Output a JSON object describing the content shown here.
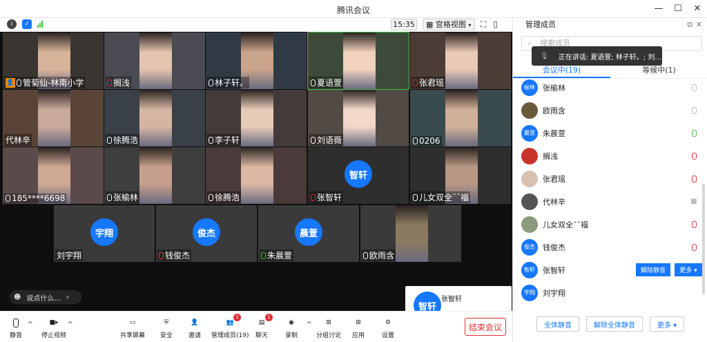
{
  "window": {
    "title": "腾讯会议"
  },
  "toolbar": {
    "time": "15:35",
    "view_label": "宫格视图"
  },
  "tiles": [
    {
      "name": "管菊仙-林南小学",
      "mic": "on",
      "host": true
    },
    {
      "name": "搁浅",
      "mic": "muted"
    },
    {
      "name": "林子轩。",
      "mic": "on"
    },
    {
      "name": "夏语萱",
      "mic": "on"
    },
    {
      "name": "张君瑶",
      "mic": "muted"
    },
    {
      "name": "代林辛",
      "mic": "none"
    },
    {
      "name": "徐腾浩",
      "mic": "on"
    },
    {
      "name": "李子轩",
      "mic": "on"
    },
    {
      "name": "刘语薇",
      "mic": "on"
    },
    {
      "name": "0206",
      "mic": "on"
    },
    {
      "name": "185****6698",
      "mic": "on"
    },
    {
      "name": "张榆林",
      "mic": "on"
    },
    {
      "name": "徐腾浩",
      "mic": "on"
    },
    {
      "name": "张智轩",
      "mic": "muted",
      "avatar": "智轩"
    },
    {
      "name": "儿女双全¯¯福",
      "mic": "on"
    },
    {
      "name": "刘宇翔",
      "mic": "none",
      "avatar": "宇翔"
    },
    {
      "name": "钱俊杰",
      "mic": "muted",
      "avatar": "俊杰"
    },
    {
      "name": "朱晨萱",
      "mic": "green",
      "avatar": "晨萱"
    },
    {
      "name": "欧雨含",
      "mic": "on"
    }
  ],
  "chat": {
    "placeholder": "说点什么..."
  },
  "float_card": {
    "avatar": "智轩",
    "name": "张智轩"
  },
  "bottombar": {
    "mute": "静音",
    "stop_video": "停止视频",
    "share": "共享屏幕",
    "security": "安全",
    "invite": "邀请",
    "members": "管理成员(19)",
    "members_badge": "1",
    "chat": "聊天",
    "chat_badge": "1",
    "record": "录制",
    "breakout": "分组讨论",
    "apps": "应用",
    "settings": "设置",
    "end": "结束会议"
  },
  "panel": {
    "title": "管理成员",
    "search_placeholder": "搜索成员",
    "speaking": "正在讲话: 夏语萱; 林子轩。; 刘...",
    "tab_in_meeting": "会议中(19)",
    "tab_waiting": "等候中(1)",
    "members": [
      {
        "avatar": "榆林",
        "name": "张榆林",
        "mic": "on",
        "photo": false
      },
      {
        "avatar": "",
        "name": "欧雨含",
        "mic": "on",
        "photo": true,
        "color": "#6a5a3a"
      },
      {
        "avatar": "晨萱",
        "name": "朱晨萱",
        "mic": "green",
        "photo": false
      },
      {
        "avatar": "",
        "name": "搁浅",
        "mic": "muted",
        "photo": true,
        "color": "#c8342a"
      },
      {
        "avatar": "",
        "name": "张君瑶",
        "mic": "muted",
        "photo": true,
        "color": "#d9c1b0"
      },
      {
        "avatar": "",
        "name": "代林辛",
        "mic": "cam",
        "photo": true,
        "color": "#555"
      },
      {
        "avatar": "",
        "name": "儿女双全¯¯福",
        "mic": "muted",
        "photo": true,
        "color": "#8a9a7a"
      },
      {
        "avatar": "俊杰",
        "name": "钱俊杰",
        "mic": "muted",
        "photo": false
      },
      {
        "avatar": "智轩",
        "name": "张智轩",
        "mic": "buttons",
        "photo": false
      },
      {
        "avatar": "宇翔",
        "name": "刘宇翔",
        "mic": "none",
        "photo": false
      }
    ],
    "unmute_label": "解除静音",
    "more_label": "更多 ▾",
    "mute_all": "全体静音",
    "unmute_all": "解除全体静音",
    "more": "更多 ▾"
  }
}
